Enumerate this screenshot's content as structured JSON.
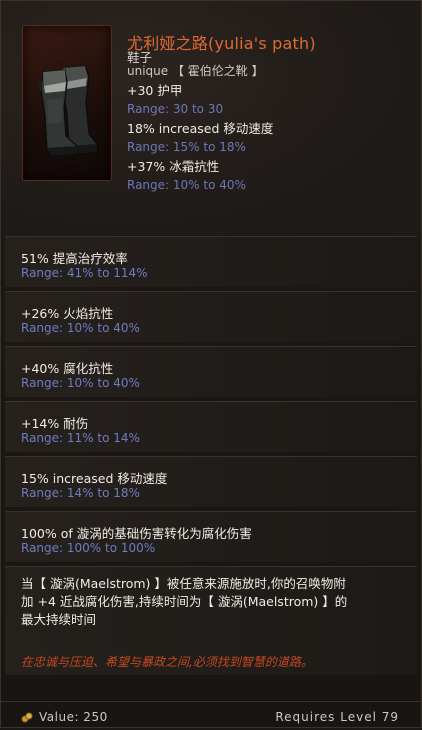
{
  "item": {
    "name": "尤利娅之路(yulia's path)",
    "type": "鞋子",
    "rarity": "unique 【 霍伯伦之靴 】",
    "image_icon": "boots-icon"
  },
  "implicits": [
    {
      "line": "+30 护甲",
      "range": "Range: 30 to 30"
    },
    {
      "line": "18% increased 移动速度",
      "range": "Range: 15% to 18%"
    },
    {
      "line": "+37% 冰霜抗性",
      "range": "Range: 10% to 40%"
    }
  ],
  "affixes": [
    {
      "line": "51% 提高治疗效率",
      "range": "Range: 41% to 114%"
    },
    {
      "line": "+26% 火焰抗性",
      "range": "Range: 10% to 40%"
    },
    {
      "line": "+40% 腐化抗性",
      "range": "Range: 10% to 40%"
    },
    {
      "line": "+14% 耐伤",
      "range": "Range: 11% to 14%"
    },
    {
      "line": "15% increased 移动速度",
      "range": "Range: 14% to 18%"
    },
    {
      "line": "100% of 漩涡的基础伤害转化为腐化伤害",
      "range": "Range: 100% to 100%"
    }
  ],
  "unique_effect": {
    "line1": "当【 漩涡(Maelstrom) 】被任意来源施放时,你的召唤物附",
    "line2": "加 +4 近战腐化伤害,持续时间为【 漩涡(Maelstrom) 】的",
    "line3": "最大持续时间"
  },
  "lore": "在忠诚与压迫、希望与暴政之间,必须找到智慧的道路。",
  "footer": {
    "value": "Value: 250",
    "requires": "Requires Level 79",
    "coin_icon": "gold-coin-icon"
  },
  "colors": {
    "name": "#e06a33",
    "range": "#6e7cc2",
    "lore": "#c8491e"
  }
}
